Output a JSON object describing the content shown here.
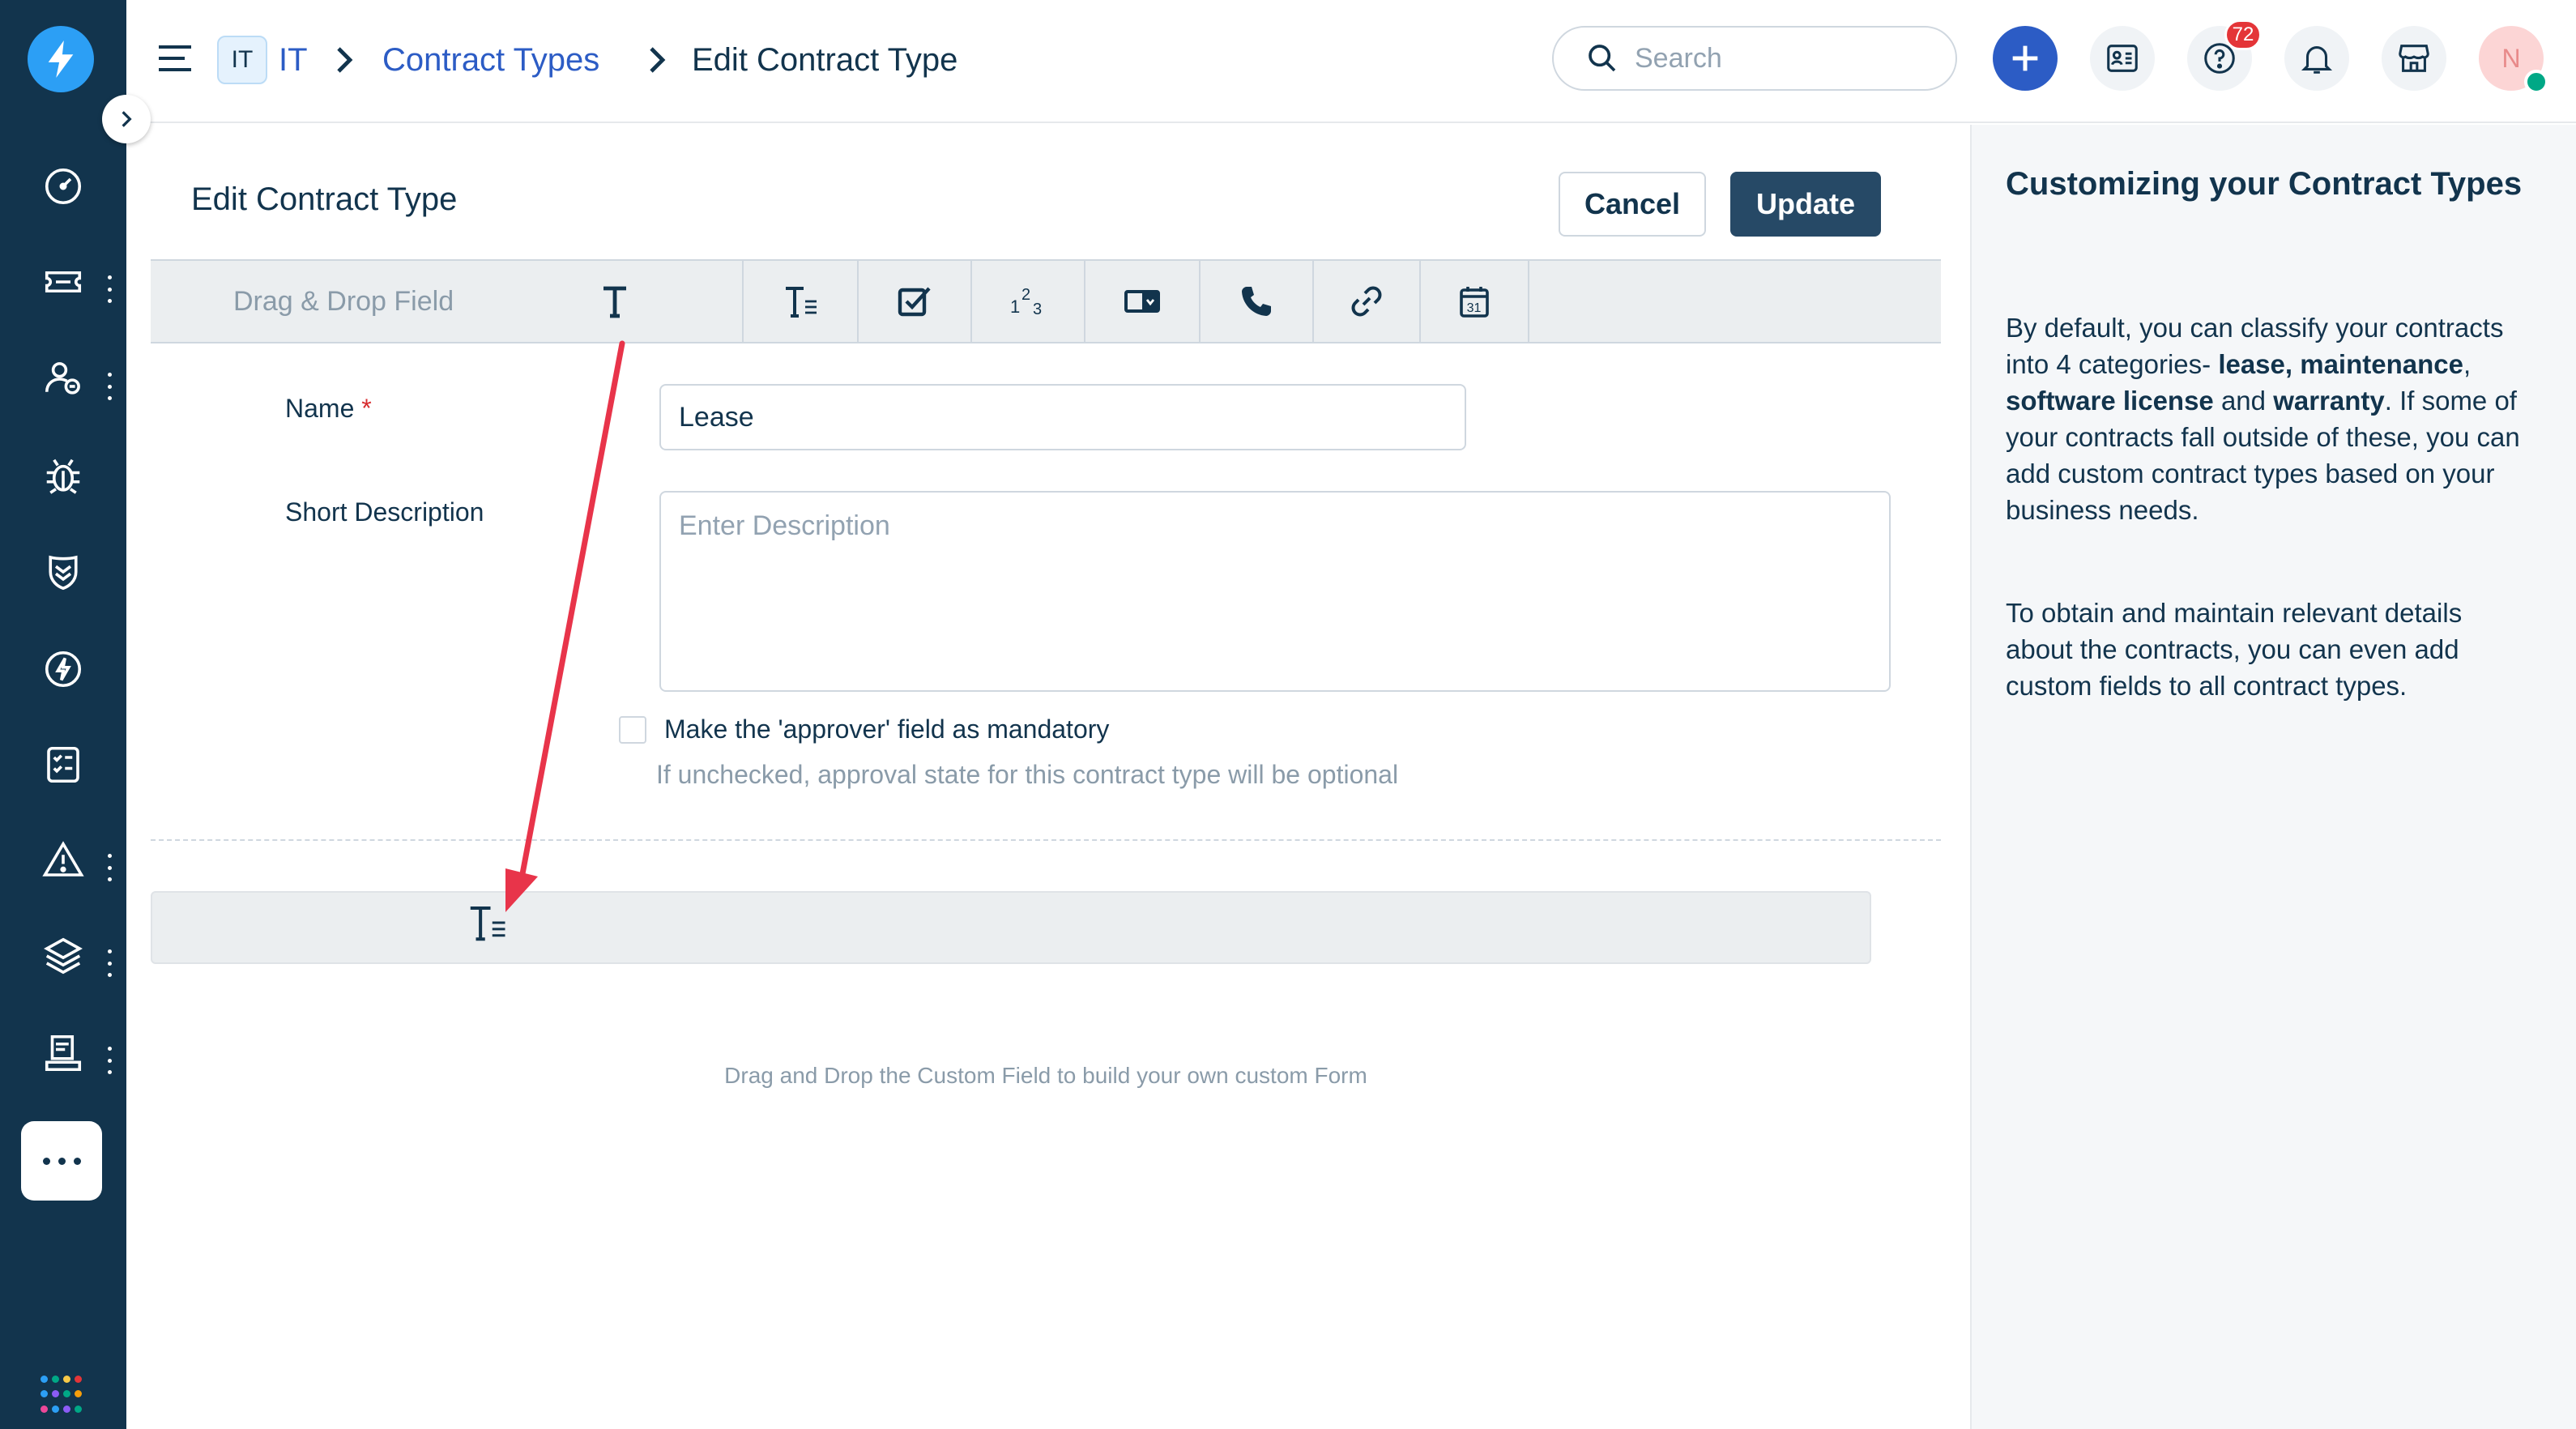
{
  "header": {
    "workspace_badge": "IT",
    "breadcrumbs": [
      "IT",
      "Contract Types",
      "Edit Contract Type"
    ],
    "search_placeholder": "Search",
    "help_badge_count": "72",
    "avatar_initial": "N"
  },
  "page": {
    "title": "Edit Contract Type",
    "cancel_label": "Cancel",
    "update_label": "Update"
  },
  "toolbar": {
    "label": "Drag & Drop Field",
    "fields": [
      "text-field-icon",
      "paragraph-field-icon",
      "checkbox-field-icon",
      "number-field-icon",
      "dropdown-field-icon",
      "phone-field-icon",
      "url-field-icon",
      "date-field-icon"
    ]
  },
  "form": {
    "name_label": "Name",
    "required_marker": "*",
    "name_value": "Lease",
    "desc_label": "Short Description",
    "desc_placeholder": "Enter Description",
    "approver_checkbox_label": "Make the 'approver' field as mandatory",
    "approver_checked": false,
    "approver_hint": "If unchecked, approval state for this contract type will be optional"
  },
  "dropzone": {
    "hint": "Drag and Drop the Custom Field to build your own custom Form"
  },
  "help": {
    "title": "Customizing your Contract Types",
    "p1_intro": "By default, you can classify your contracts into 4 categories- ",
    "p1_lease": "lease,",
    "p1_maintenance": "maintenance",
    "p1_sep1": ", ",
    "p1_software": "software license",
    "p1_and": " and ",
    "p1_warranty": "warranty",
    "p1_rest": ". If some of your contracts fall outside of these, you can add custom contract types based on your business needs.",
    "p2": "To obtain and maintain relevant details about the contracts, you can even add custom fields to all contract types."
  },
  "colors": {
    "sidebar": "#12344d",
    "primary_button": "#264966",
    "link": "#2c5cc5",
    "annotation_arrow": "#e8344a",
    "badge": "#e43538"
  }
}
